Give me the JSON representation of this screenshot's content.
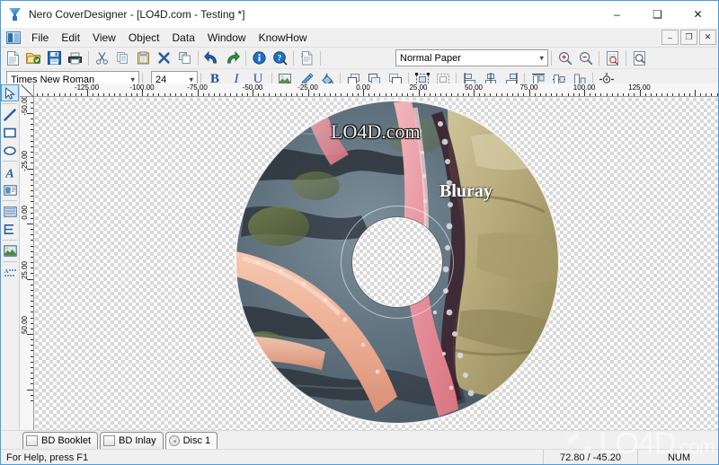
{
  "window": {
    "title": "Nero CoverDesigner - [LO4D.com - Testing *]",
    "app_icon": "nero-coverdesigner-icon",
    "minimize": "–",
    "maximize": "❑",
    "close": "✕"
  },
  "mdi_controls": {
    "restore_down_icon": "mdi-minimize-icon",
    "restore_icon": "mdi-restore-icon",
    "close_icon": "mdi-close-icon",
    "minimize": "–",
    "restore": "❐",
    "close": "✕"
  },
  "menu": {
    "document_icon": "document-window-icon",
    "items": [
      {
        "label": "File"
      },
      {
        "label": "Edit"
      },
      {
        "label": "View"
      },
      {
        "label": "Object"
      },
      {
        "label": "Data"
      },
      {
        "label": "Window"
      },
      {
        "label": "KnowHow"
      }
    ]
  },
  "toolbar_main": {
    "buttons": [
      {
        "name": "new-document-button",
        "icon": "new-document-icon",
        "tooltip": "New"
      },
      {
        "name": "open-document-button",
        "icon": "open-folder-icon",
        "tooltip": "Open"
      },
      {
        "name": "save-document-button",
        "icon": "floppy-disk-icon",
        "tooltip": "Save"
      },
      {
        "name": "print-button",
        "icon": "printer-icon",
        "tooltip": "Print"
      },
      {
        "name": "cut-button",
        "icon": "scissors-icon",
        "tooltip": "Cut"
      },
      {
        "name": "copy-button",
        "icon": "copy-icon",
        "tooltip": "Copy"
      },
      {
        "name": "paste-button",
        "icon": "clipboard-paste-icon",
        "tooltip": "Paste"
      },
      {
        "name": "delete-button",
        "icon": "delete-x-icon",
        "tooltip": "Delete"
      },
      {
        "name": "duplicate-button",
        "icon": "duplicate-icon",
        "tooltip": "Duplicate"
      },
      {
        "name": "undo-button",
        "icon": "undo-arrow-icon",
        "tooltip": "Undo"
      },
      {
        "name": "redo-button",
        "icon": "redo-arrow-icon",
        "tooltip": "Redo"
      },
      {
        "name": "info-button",
        "icon": "info-circle-icon",
        "tooltip": "Document info"
      },
      {
        "name": "help-search-button",
        "icon": "help-magnifier-icon",
        "tooltip": "Help"
      },
      {
        "name": "properties-button",
        "icon": "page-properties-icon",
        "tooltip": "Properties"
      }
    ],
    "paper_select": {
      "value": "Normal Paper",
      "options": [
        "Normal Paper"
      ]
    },
    "zoom_in": {
      "name": "zoom-in-button",
      "icon": "magnifier-plus-icon"
    },
    "zoom_out": {
      "name": "zoom-out-button",
      "icon": "magnifier-minus-icon"
    },
    "print_preview": {
      "name": "print-preview-button",
      "icon": "page-preview-icon"
    },
    "page_view": {
      "name": "page-view-button",
      "icon": "page-magnifier-icon"
    }
  },
  "toolbar_format": {
    "font_select": {
      "value": "Times New Roman",
      "options": [
        "Times New Roman"
      ]
    },
    "size_select": {
      "value": "24",
      "options": [
        "24"
      ]
    },
    "bold": {
      "label": "B",
      "name": "bold-button"
    },
    "italic": {
      "label": "I",
      "name": "italic-button"
    },
    "underline": {
      "label": "U",
      "name": "underline-button"
    },
    "buttons": [
      {
        "name": "background-properties-button",
        "icon": "image-properties-icon"
      },
      {
        "name": "pen-color-button",
        "icon": "pen-icon"
      },
      {
        "name": "fill-color-button",
        "icon": "paint-fill-icon"
      },
      {
        "name": "bring-to-front-button",
        "icon": "bring-front-icon"
      },
      {
        "name": "send-to-back-button",
        "icon": "send-back-icon"
      },
      {
        "name": "bring-forward-button",
        "icon": "bring-forward-icon"
      },
      {
        "name": "select-all-button",
        "icon": "select-all-icon"
      },
      {
        "name": "deselect-button",
        "icon": "deselect-icon"
      },
      {
        "name": "align-left-button",
        "icon": "align-left-icon"
      },
      {
        "name": "align-center-button",
        "icon": "align-center-icon"
      },
      {
        "name": "align-right-button",
        "icon": "align-right-icon"
      },
      {
        "name": "align-top-button",
        "icon": "align-top-icon"
      },
      {
        "name": "align-middle-button",
        "icon": "align-middle-icon"
      },
      {
        "name": "align-bottom-button",
        "icon": "align-bottom-icon"
      },
      {
        "name": "center-on-page-button",
        "icon": "center-on-page-icon"
      }
    ]
  },
  "tools_palette": {
    "items": [
      {
        "name": "tool-select",
        "icon": "arrow-cursor-icon",
        "active": true
      },
      {
        "name": "tool-line",
        "icon": "line-icon",
        "active": false
      },
      {
        "name": "tool-rectangle",
        "icon": "rectangle-icon",
        "active": false
      },
      {
        "name": "tool-ellipse",
        "icon": "ellipse-icon",
        "active": false
      },
      {
        "name": "tool-artistic-text",
        "icon": "letter-a-icon",
        "active": false
      },
      {
        "name": "tool-text-box",
        "icon": "text-box-icon",
        "active": false
      },
      {
        "name": "tool-field",
        "icon": "field-lines-icon",
        "active": false
      },
      {
        "name": "tool-track-list",
        "icon": "track-list-icon",
        "active": false
      },
      {
        "name": "tool-image",
        "icon": "picture-icon",
        "active": false
      },
      {
        "name": "tool-playlist",
        "icon": "playlist-icon",
        "active": false
      }
    ]
  },
  "rulers": {
    "horizontal": {
      "labels": [
        "-125.00",
        "-100.00",
        "-75.00",
        "-50.00",
        "-25.00",
        "0.00",
        "25.00",
        "50.00",
        "75.00",
        "100.00",
        "125.00"
      ],
      "unit": "mm"
    },
    "vertical": {
      "labels": [
        "-50.00",
        "-25.00",
        "0.00",
        "25.00",
        "50.00"
      ],
      "unit": "mm"
    }
  },
  "canvas": {
    "disc": {
      "label_top": "LO4D.com",
      "label_main": "Bluray",
      "artwork": "starfish-rockpool-photo"
    }
  },
  "tabs": [
    {
      "label": "BD Booklet",
      "icon": "booklet-icon",
      "active": false
    },
    {
      "label": "BD Inlay",
      "icon": "inlay-icon",
      "active": false
    },
    {
      "label": "Disc 1",
      "icon": "disc-icon",
      "active": true
    }
  ],
  "statusbar": {
    "help_text": "For Help, press F1",
    "coordinates": "72.80 / -45.20",
    "num_lock": "NUM"
  },
  "watermark": {
    "text_main": "LO4D",
    "text_suffix": ".com",
    "icon": "lo4d-refresh-arrows-icon"
  }
}
